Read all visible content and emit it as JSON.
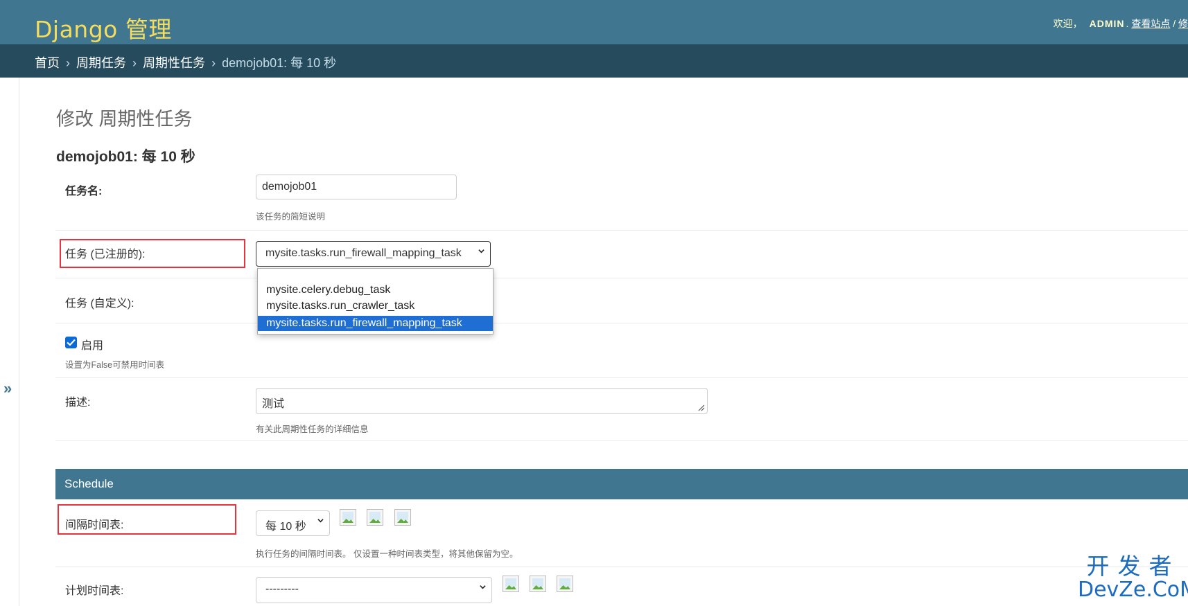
{
  "header": {
    "brand": "Django 管理",
    "welcome": "欢迎，",
    "user": "ADMIN",
    "period": ".",
    "view_site": "查看站点",
    "divider": " / ",
    "truncated_link": "修"
  },
  "breadcrumbs": {
    "home": "首页",
    "app": "周期任务",
    "model": "周期性任务",
    "current": "demojob01: 每 10 秒",
    "separator": "›"
  },
  "nav_toggle": "»",
  "page_title": "修改 周期性任务",
  "object_title": "demojob01: 每 10 秒",
  "form": {
    "name": {
      "label": "任务名:",
      "value": "demojob01",
      "help": "该任务的简短说明"
    },
    "task_registered": {
      "label": "任务 (已注册的):",
      "selected": "mysite.tasks.run_firewall_mapping_task",
      "options": [
        "",
        "mysite.celery.debug_task",
        "mysite.tasks.run_crawler_task",
        "mysite.tasks.run_firewall_mapping_task"
      ]
    },
    "task_custom": {
      "label": "任务 (自定义):"
    },
    "enabled": {
      "label": "启用",
      "checked": true,
      "help": "设置为False可禁用时间表"
    },
    "description": {
      "label": "描述:",
      "value": "测试",
      "help": "有关此周期性任务的详细信息"
    }
  },
  "schedule": {
    "header": "Schedule",
    "interval": {
      "label": "间隔时间表:",
      "selected": "每 10 秒",
      "help": "执行任务的间隔时间表。 仅设置一种时间表类型，将其他保留为空。"
    },
    "crontab": {
      "label": "计划时间表:",
      "selected": "---------"
    }
  },
  "icons": {
    "related": [
      "change-related-icon",
      "add-related-icon",
      "view-related-icon"
    ]
  },
  "watermark": {
    "cn": "开发者",
    "en": "DevZe.CoM"
  },
  "colors": {
    "header_bg": "#417690",
    "breadcrumbs_bg": "#264b5d",
    "brand_yellow": "#f5dd5d",
    "highlight_red": "#e8323c",
    "selected_option_bg": "#1f6ed4",
    "watermark_blue": "#1b6bc1"
  }
}
